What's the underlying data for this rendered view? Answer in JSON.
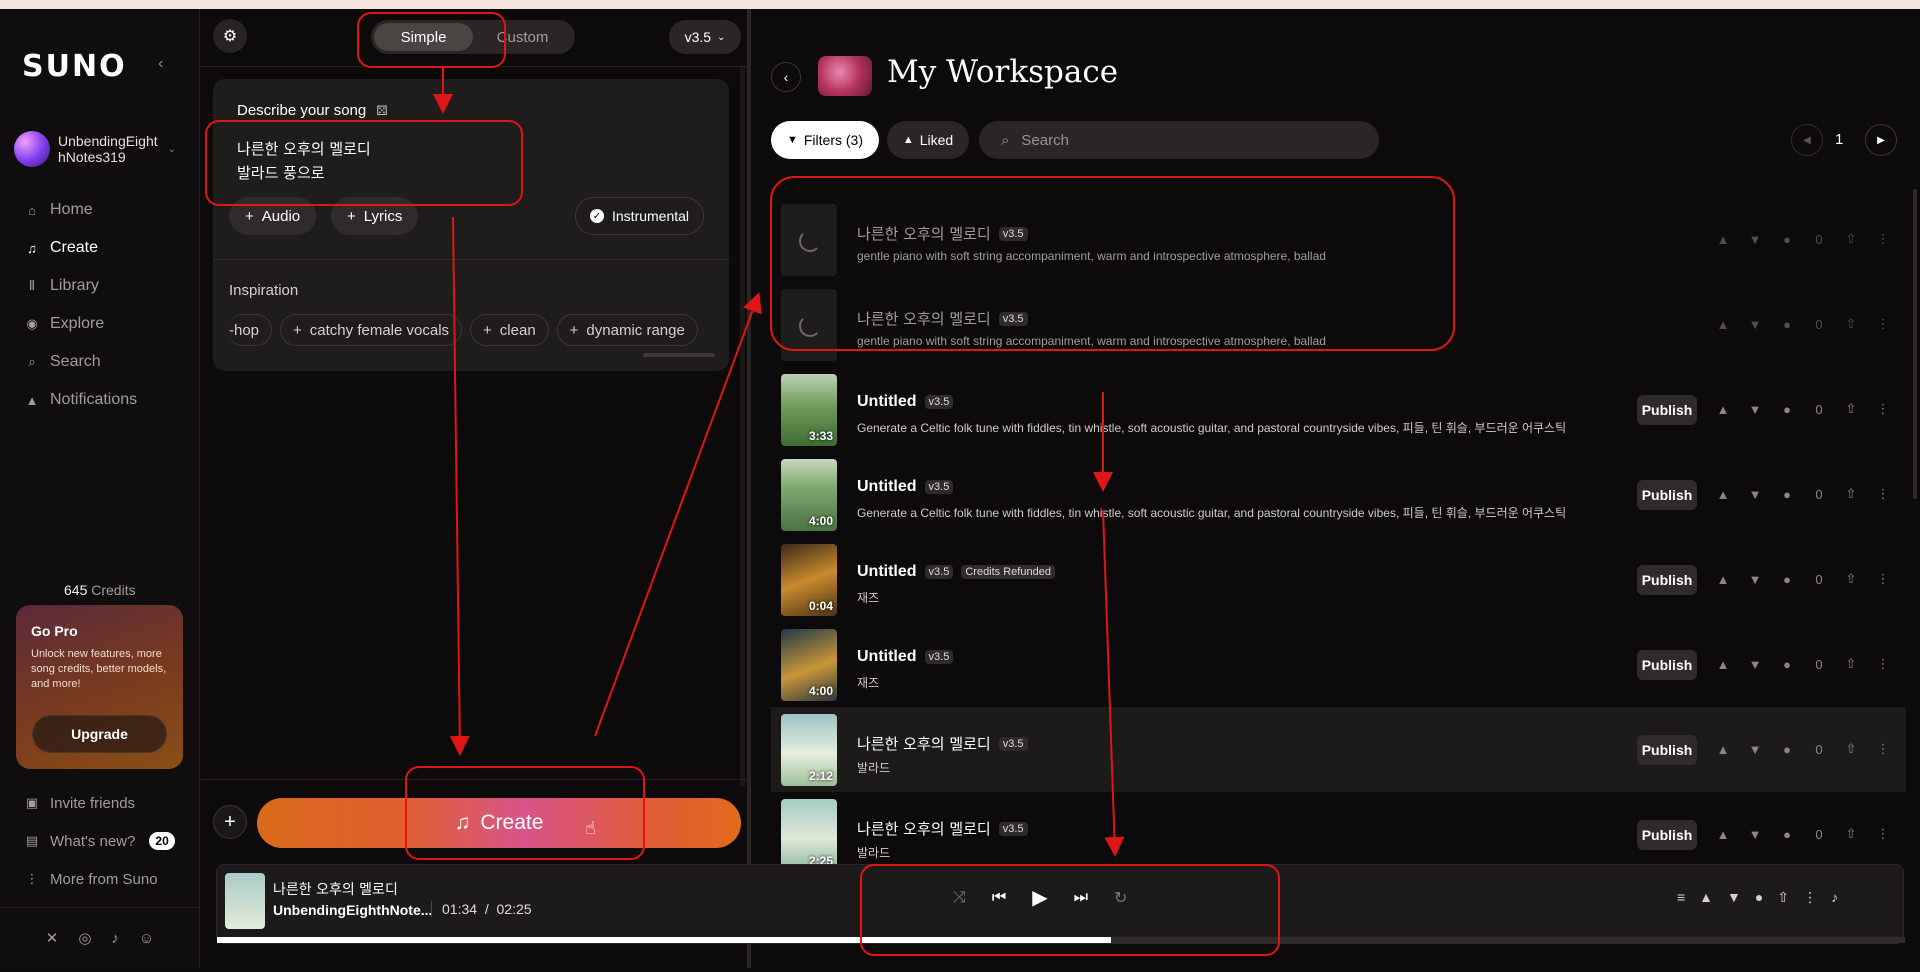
{
  "sidebar": {
    "logo": "SUNO",
    "username": "UnbendingEighthNotes319",
    "username_line1": "UnbendingEight",
    "username_line2": "hNotes319",
    "nav": [
      {
        "label": "Home",
        "icon": "home-icon"
      },
      {
        "label": "Create",
        "icon": "create-icon"
      },
      {
        "label": "Library",
        "icon": "library-icon"
      },
      {
        "label": "Explore",
        "icon": "explore-icon"
      },
      {
        "label": "Search",
        "icon": "search-icon"
      },
      {
        "label": "Notifications",
        "icon": "bell-icon"
      }
    ],
    "credits_value": "645",
    "credits_label": "Credits",
    "gopro": {
      "title": "Go Pro",
      "desc": "Unlock new features, more song credits, better models, and more!",
      "button": "Upgrade"
    },
    "bottom_nav": [
      {
        "label": "Invite friends",
        "icon": "gift-icon"
      },
      {
        "label": "What's new?",
        "icon": "news-icon",
        "badge": "20"
      },
      {
        "label": "More from Suno",
        "icon": "more-vertical-icon"
      }
    ],
    "socials": [
      "x-icon",
      "instagram-icon",
      "tiktok-icon",
      "discord-icon"
    ]
  },
  "create": {
    "mode_simple": "Simple",
    "mode_custom": "Custom",
    "version": "v3.5",
    "describe_label": "Describe your song",
    "prompt_line1": "나른한 오후의 멜로디",
    "prompt_line2": "발라드 풍으로",
    "audio_chip": "Audio",
    "lyrics_chip": "Lyrics",
    "instrumental": "Instrumental",
    "inspiration_label": "Inspiration",
    "inspiration": [
      "-hop",
      "catchy female vocals",
      "clean",
      "dynamic range"
    ],
    "create_button": "Create"
  },
  "workspace": {
    "title": "My Workspace",
    "filters": "Filters (3)",
    "liked": "Liked",
    "search_placeholder": "Search",
    "page": "1",
    "songs": [
      {
        "title": "나른한 오후의 멜로디",
        "version": "v3.5",
        "desc": "gentle piano with soft string accompaniment, warm and introspective atmosphere, ballad",
        "status": "loading",
        "likes": "0"
      },
      {
        "title": "나른한 오후의 멜로디",
        "version": "v3.5",
        "desc": "gentle piano with soft string accompaniment, warm and introspective atmosphere, ballad",
        "status": "loading",
        "likes": "0"
      },
      {
        "title": "Untitled",
        "version": "v3.5",
        "desc": "Generate a Celtic folk tune with fiddles, tin whistle, soft acoustic guitar, and pastoral countryside vibes, 피들, 틴 휘슬, 부드러운 어쿠스틱",
        "duration": "3:33",
        "publish": "Publish",
        "likes": "0"
      },
      {
        "title": "Untitled",
        "version": "v3.5",
        "desc": "Generate a Celtic folk tune with fiddles, tin whistle, soft acoustic guitar, and pastoral countryside vibes, 피들, 틴 휘슬, 부드러운 어쿠스틱",
        "duration": "4:00",
        "publish": "Publish",
        "likes": "0"
      },
      {
        "title": "Untitled",
        "version": "v3.5",
        "tag": "Credits Refunded",
        "desc": "재즈",
        "duration": "0:04",
        "publish": "Publish",
        "likes": "0"
      },
      {
        "title": "Untitled",
        "version": "v3.5",
        "desc": "재즈",
        "duration": "4:00",
        "publish": "Publish",
        "likes": "0"
      },
      {
        "title": "나른한 오후의 멜로디",
        "version": "v3.5",
        "desc": "발라드",
        "duration": "2:12",
        "publish": "Publish",
        "likes": "0"
      },
      {
        "title": "나른한 오후의 멜로디",
        "version": "v3.5",
        "desc": "발라드",
        "duration": "2:25",
        "publish": "Publish",
        "likes": "0"
      }
    ]
  },
  "player": {
    "title": "나른한 오후의 멜로디",
    "artist": "UnbendingEighthNote...",
    "current": "01:34",
    "separator": "/",
    "total": "02:25",
    "progress": 0.53
  },
  "colors": {
    "accent_start": "#d96a1a",
    "accent_mid": "#d8548a",
    "annotation": "#e01515"
  }
}
